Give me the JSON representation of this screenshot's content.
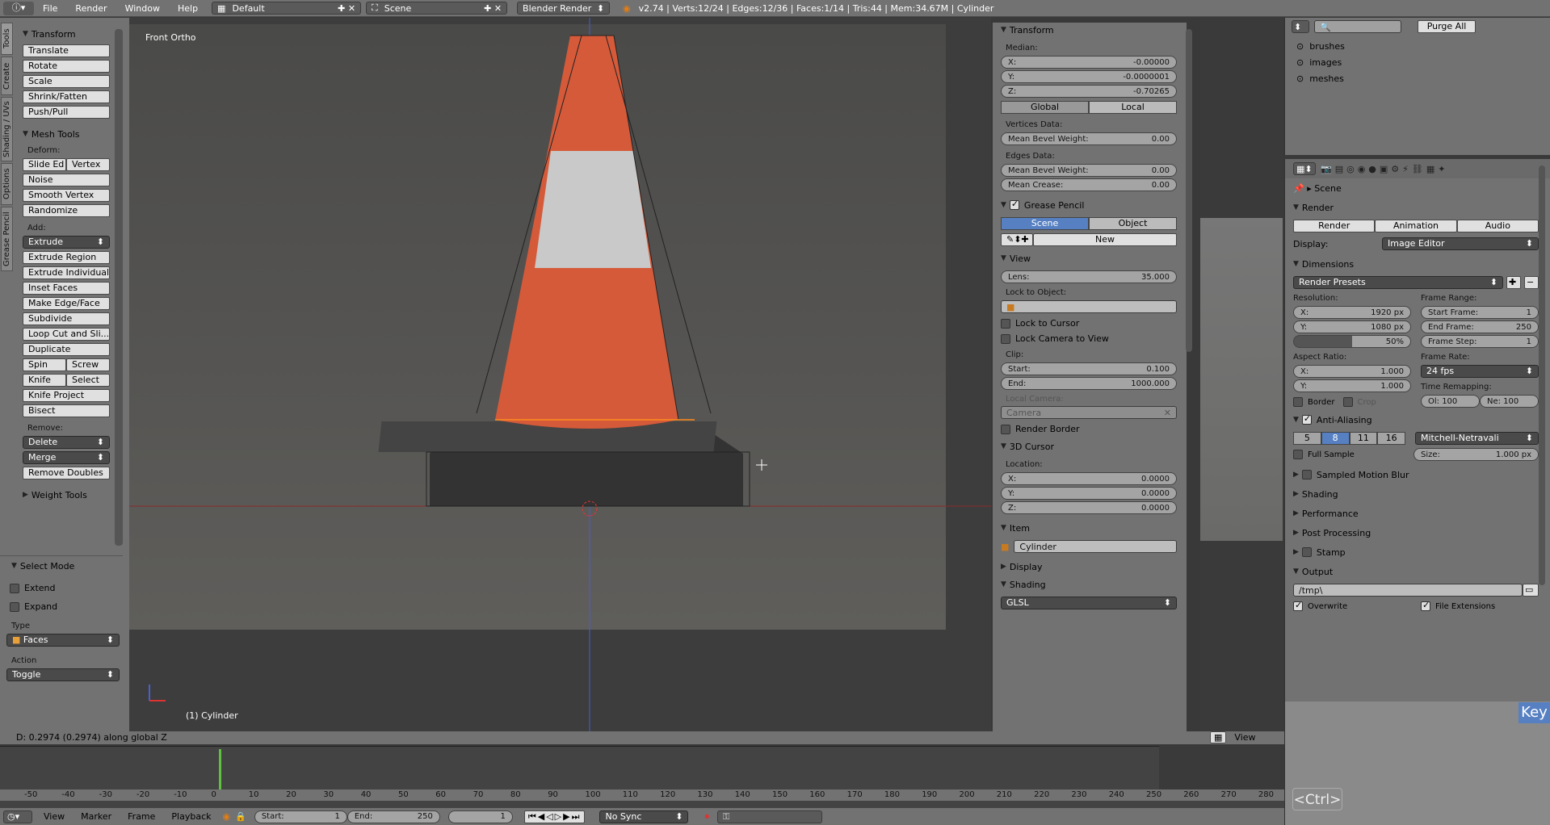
{
  "topbar": {
    "menus": [
      "File",
      "Render",
      "Window",
      "Help"
    ],
    "layout": "Default",
    "scene": "Scene",
    "engine": "Blender Render",
    "stats": "v2.74 | Verts:12/24 | Edges:12/36 | Faces:1/14 | Tris:44 | Mem:34.67M | Cylinder"
  },
  "toolshelf": {
    "tabs": [
      "Tools",
      "Create",
      "Shading / UVs",
      "Options",
      "Grease Pencil"
    ],
    "transform_header": "Transform",
    "transform_buttons": [
      "Translate",
      "Rotate",
      "Scale",
      "Shrink/Fatten",
      "Push/Pull"
    ],
    "mesh_tools_header": "Mesh Tools",
    "deform_label": "Deform:",
    "deform_row1": [
      "Slide Ed",
      "Vertex"
    ],
    "deform_buttons": [
      "Noise",
      "Smooth Vertex",
      "Randomize"
    ],
    "add_label": "Add:",
    "extrude": "Extrude",
    "add_buttons": [
      "Extrude Region",
      "Extrude Individual",
      "Inset Faces",
      "Make Edge/Face",
      "Subdivide",
      "Loop Cut and Sli...",
      "Duplicate"
    ],
    "spin_row": [
      "Spin",
      "Screw"
    ],
    "knife_row": [
      "Knife",
      "Select"
    ],
    "add_buttons2": [
      "Knife Project",
      "Bisect"
    ],
    "remove_label": "Remove:",
    "delete": "Delete",
    "merge": "Merge",
    "remove_doubles": "Remove Doubles",
    "weight_tools": "Weight Tools",
    "select_mode_header": "Select Mode",
    "extend": "Extend",
    "expand": "Expand",
    "type_label": "Type",
    "type_value": "Faces",
    "action_label": "Action",
    "action_value": "Toggle"
  },
  "viewport": {
    "view_name": "Front Ortho",
    "object_name": "(1) Cylinder",
    "status": "D: 0.2974 (0.2974) along global Z"
  },
  "npanel": {
    "transform_header": "Transform",
    "median_label": "Median:",
    "median": [
      {
        "label": "X:",
        "value": "-0.00000"
      },
      {
        "label": "Y:",
        "value": "-0.0000001"
      },
      {
        "label": "Z:",
        "value": "-0.70265"
      }
    ],
    "global": "Global",
    "local": "Local",
    "vertices_data": "Vertices Data:",
    "mean_bevel_weight": "Mean Bevel Weight:",
    "vbevel": "0.00",
    "edges_data": "Edges Data:",
    "ebevel": "0.00",
    "mean_crease": "Mean Crease:",
    "crease": "0.00",
    "grease_header": "Grease Pencil",
    "gp_scene": "Scene",
    "gp_object": "Object",
    "gp_new": "New",
    "view_header": "View",
    "lens_label": "Lens:",
    "lens": "35.000",
    "lock_to_object": "Lock to Object:",
    "lock_to_cursor": "Lock to Cursor",
    "lock_camera": "Lock Camera to View",
    "clip_label": "Clip:",
    "start_label": "Start:",
    "clip_start": "0.100",
    "end_label": "End:",
    "clip_end": "1000.000",
    "local_camera": "Local Camera:",
    "camera": "Camera",
    "render_border": "Render Border",
    "cursor_header": "3D Cursor",
    "location_label": "Location:",
    "cursor": [
      {
        "label": "X:",
        "value": "0.0000"
      },
      {
        "label": "Y:",
        "value": "0.0000"
      },
      {
        "label": "Z:",
        "value": "0.0000"
      }
    ],
    "item_header": "Item",
    "item_name": "Cylinder",
    "display_header": "Display",
    "shading_header": "Shading",
    "shading_value": "GLSL"
  },
  "outliner": {
    "purge": "Purge All",
    "items": [
      "brushes",
      "images",
      "meshes"
    ]
  },
  "properties": {
    "scene": "Scene",
    "render_header": "Render",
    "render_btns": [
      "Render",
      "Animation",
      "Audio"
    ],
    "display_label": "Display:",
    "display_value": "Image Editor",
    "dimensions_header": "Dimensions",
    "render_presets": "Render Presets",
    "resolution_label": "Resolution:",
    "res_x_label": "X:",
    "res_x": "1920 px",
    "res_y_label": "Y:",
    "res_y": "1080 px",
    "res_pct": "50%",
    "frame_range_label": "Frame Range:",
    "start_frame_label": "Start Frame:",
    "start_frame": "1",
    "end_frame_label": "End Frame:",
    "end_frame": "250",
    "frame_step_label": "Frame Step:",
    "frame_step": "1",
    "aspect_label": "Aspect Ratio:",
    "asp_x": "1.000",
    "asp_y": "1.000",
    "frame_rate_label": "Frame Rate:",
    "fps": "24 fps",
    "time_remap_label": "Time Remapping:",
    "old": "Ol: 100",
    "new": "Ne: 100",
    "border": "Border",
    "crop": "Crop",
    "aa_header": "Anti-Aliasing",
    "aa_samples": [
      "5",
      "8",
      "11",
      "16"
    ],
    "aa_filter": "Mitchell-Netravali",
    "full_sample": "Full Sample",
    "size_label": "Size:",
    "size": "1.000 px",
    "collapsed": [
      "Sampled Motion Blur",
      "Shading",
      "Performance",
      "Post Processing",
      "Stamp"
    ],
    "output_header": "Output",
    "output_path": "/tmp\\",
    "overwrite": "Overwrite",
    "file_ext": "File Extensions"
  },
  "image_editor": {
    "view": "View"
  },
  "timeline": {
    "ticks": [
      "-50",
      "-40",
      "-30",
      "-20",
      "-10",
      "0",
      "10",
      "20",
      "30",
      "40",
      "50",
      "60",
      "70",
      "80",
      "90",
      "100",
      "110",
      "120",
      "130",
      "140",
      "150",
      "160",
      "170",
      "180",
      "190",
      "200",
      "210",
      "220",
      "230",
      "240",
      "250",
      "260",
      "270",
      "280"
    ],
    "menus": [
      "View",
      "Marker",
      "Frame",
      "Playback"
    ],
    "start_label": "Start:",
    "start": "1",
    "end_label": "End:",
    "end": "250",
    "current": "1",
    "sync": "No Sync"
  },
  "keys": {
    "key": "Key",
    "ctrl": "<Ctrl>"
  }
}
